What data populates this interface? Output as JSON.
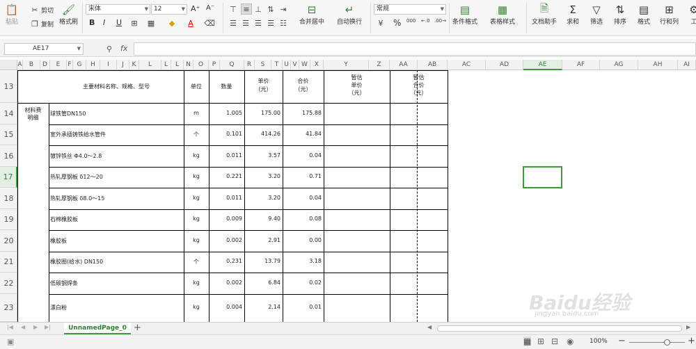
{
  "ribbon": {
    "paste_label": "粘贴",
    "cut_label": "剪切",
    "copy_label": "复制",
    "format_painter_label": "格式刷",
    "font_name": "宋体",
    "font_size": "12",
    "bold": "B",
    "italic": "I",
    "underline": "U",
    "merge_center_label": "合并居中",
    "wrap_text_label": "自动换行",
    "number_format": "常规",
    "percent": "%",
    "thousands": "000",
    "conditional_format_label": "条件格式",
    "table_style_label": "表格样式",
    "doc_helper_label": "文档助手",
    "sum_label": "求和",
    "filter_label": "筛选",
    "sort_label": "排序",
    "format_label": "格式",
    "rows_cols_label": "行和列",
    "work_label": "工"
  },
  "formula_bar": {
    "name_box": "AE17",
    "fx": "fx"
  },
  "columns": [
    "A",
    "B",
    "D",
    "E",
    "F",
    "G",
    "H",
    "I",
    "J",
    "K",
    "L",
    "N",
    "O",
    "P",
    "Q",
    "R",
    "S",
    "T",
    "U",
    "V",
    "W",
    "X",
    "Y",
    "Z",
    "AA",
    "AB",
    "AC",
    "AD",
    "AE",
    "AF",
    "AG",
    "AH",
    "AI"
  ],
  "active_column": "AE",
  "rows": [
    "13",
    "14",
    "15",
    "16",
    "17",
    "18",
    "19",
    "20",
    "21",
    "22",
    "23"
  ],
  "active_row": "17",
  "table": {
    "headers": {
      "material": "主要材料名称、规格、型号",
      "unit": "单位",
      "qty": "数量",
      "unit_price_1": "单价",
      "unit_price_2": "（元）",
      "total_price_1": "合价",
      "total_price_2": "（元）",
      "est_unit_1": "暂估",
      "est_unit_2": "单价",
      "est_unit_3": "（元）",
      "est_total_1": "暂估",
      "est_total_2": "合价",
      "est_total_3": "（元）"
    },
    "side_label_1": "材料费",
    "side_label_2": "明细",
    "items": [
      {
        "name": "球铁管DN150",
        "unit": "m",
        "qty": "1.005",
        "price": "175.00",
        "total": "175.88"
      },
      {
        "name": "室外承插铸铁给水管件",
        "unit": "个",
        "qty": "0.101",
        "price": "414.26",
        "total": "41.84"
      },
      {
        "name": "镀锌铁丝 Φ4.0～2.8",
        "unit": "kg",
        "qty": "0.011",
        "price": "3.57",
        "total": "0.04"
      },
      {
        "name": "热轧厚钢板 δ12～20",
        "unit": "kg",
        "qty": "0.221",
        "price": "3.20",
        "total": "0.71"
      },
      {
        "name": "热轧厚钢板 δ8.0～15",
        "unit": "kg",
        "qty": "0.011",
        "price": "3.20",
        "total": "0.04"
      },
      {
        "name": "石棉橡胶板",
        "unit": "kg",
        "qty": "0.009",
        "price": "9.40",
        "total": "0.08"
      },
      {
        "name": "橡胶板",
        "unit": "kg",
        "qty": "0.002",
        "price": "2.91",
        "total": "0.00"
      },
      {
        "name": "橡胶圈(给水) DN150",
        "unit": "个",
        "qty": "0.231",
        "price": "13.79",
        "total": "3.18"
      },
      {
        "name": "低碳钢焊条",
        "unit": "kg",
        "qty": "0.002",
        "price": "6.84",
        "total": "0.02"
      },
      {
        "name": "漂白粉",
        "unit": "kg",
        "qty": "0.004",
        "price": "2.14",
        "total": "0.01"
      }
    ]
  },
  "sheet_tab": "UnnamedPage_0",
  "add_sheet": "+",
  "zoom": "100%",
  "zoom_minus": "−",
  "zoom_plus": "+",
  "watermark": "Baidu经验",
  "watermark_url": "jingyan.baidu.com"
}
